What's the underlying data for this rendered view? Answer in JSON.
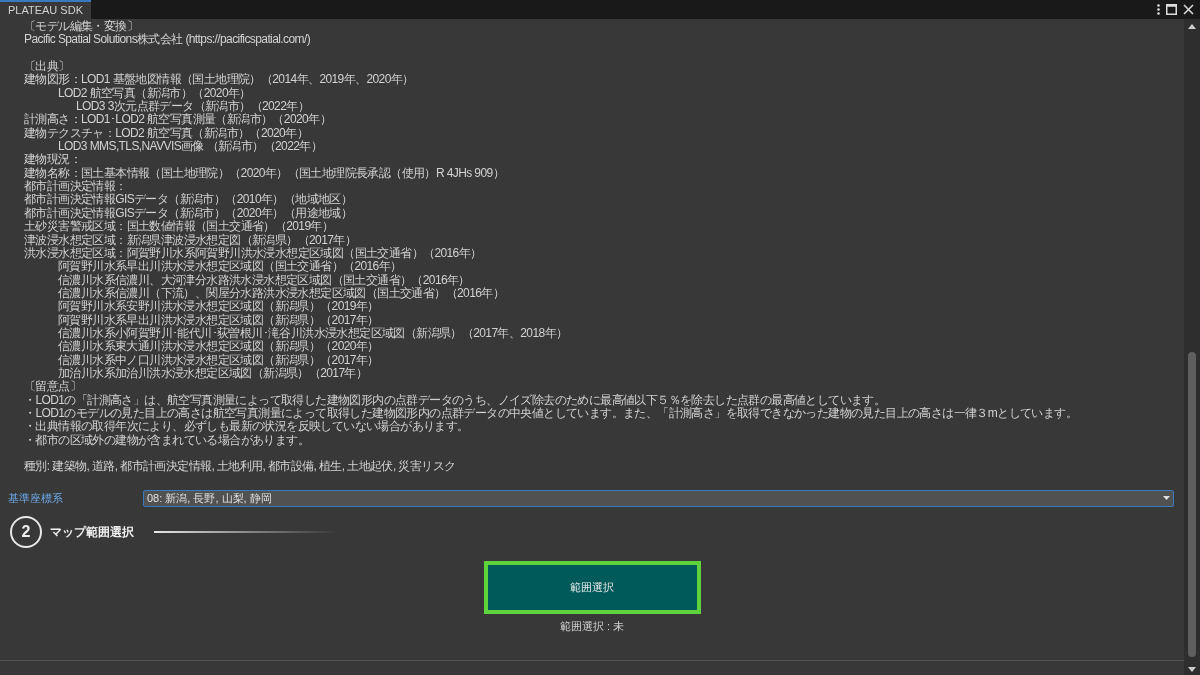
{
  "window": {
    "title": "PLATEAU SDK"
  },
  "license_text": {
    "sections": [
      {
        "lines": [
          {
            "text": "〔モデル編集・変換〕"
          },
          {
            "text": "Pacific Spatial Solutions株式会社 (https://pacificspatial.com/)"
          }
        ]
      },
      {
        "lines": [
          {
            "text": "〔出典〕"
          },
          {
            "text": "建物図形：LOD1 基盤地図情報（国土地理院）（2014年、2019年、2020年）",
            "children": [
              {
                "text": "LOD2 航空写真（新潟市）（2020年）",
                "children": [
                  {
                    "text": "LOD3 3次元点群データ（新潟市）（2022年）"
                  }
                ]
              }
            ]
          },
          {
            "text": "計測高さ：LOD1･LOD2 航空写真測量（新潟市）（2020年）"
          },
          {
            "text": "建物テクスチャ：LOD2 航空写真（新潟市）（2020年）",
            "children": [
              {
                "text": "LOD3 MMS,TLS,NAVVIS画像 （新潟市）（2022年）"
              }
            ]
          },
          {
            "text": "建物現況："
          },
          {
            "text": "建物名称：国土基本情報（国土地理院）（2020年）（国土地理院長承認（使用）R 4JHs 909）"
          },
          {
            "text": "都市計画決定情報："
          },
          {
            "text": "都市計画決定情報GISデータ（新潟市）（2010年）（地域地区）"
          },
          {
            "text": "都市計画決定情報GISデータ（新潟市）（2020年）（用途地域）"
          },
          {
            "text": "土砂災害警戒区域：国土数値情報（国土交通省）（2019年）"
          },
          {
            "text": "津波浸水想定区域：新潟県津波浸水想定図（新潟県）（2017年）"
          },
          {
            "text": "洪水浸水想定区域：阿賀野川水系阿賀野川洪水浸水想定区域図（国土交通省）（2016年）",
            "children": [
              {
                "text": "阿賀野川水系早出川洪水浸水想定区域図（国土交通省）（2016年）"
              },
              {
                "text": "信濃川水系信濃川、大河津分水路洪水浸水想定区域図（国土交通省）（2016年）"
              },
              {
                "text": "信濃川水系信濃川（下流）、関屋分水路洪水浸水想定区域図（国土交通省）（2016年）"
              },
              {
                "text": "阿賀野川水系安野川洪水浸水想定区域図（新潟県）（2019年）"
              },
              {
                "text": "阿賀野川水系早出川洪水浸水想定区域図（新潟県）（2017年）"
              },
              {
                "text": "信濃川水系小阿賀野川･能代川･荻曽根川･滝谷川洪水浸水想定区域図（新潟県）（2017年、2018年）"
              },
              {
                "text": "信濃川水系東大通川洪水浸水想定区域図（新潟県）（2020年）"
              },
              {
                "text": "信濃川水系中ノ口川洪水浸水想定区域図（新潟県）（2017年）"
              },
              {
                "text": "加治川水系加治川洪水浸水想定区域図（新潟県）（2017年）"
              }
            ]
          },
          {
            "text": "〔留意点〕"
          },
          {
            "text": "・LOD1の「計測高さ」は、航空写真測量によって取得した建物図形内の点群データのうち、ノイズ除去のために最高値以下５％を除去した点群の最高値としています。"
          },
          {
            "text": "・LOD1のモデルの見た目上の高さは航空写真測量によって取得した建物図形内の点群データの中央値としています。また、「計測高さ」を取得できなかった建物の見た目上の高さは一律３mとしています。"
          },
          {
            "text": "・出典情報の取得年次により、必ずしも最新の状況を反映していない場合があります。"
          },
          {
            "text": "・都市の区域外の建物が含まれている場合があります。"
          }
        ]
      },
      {
        "lines": [
          {
            "text": "種別: 建築物, 道路, 都市計画決定情報, 土地利用, 都市設備, 植生, 土地起伏, 災害リスク"
          }
        ]
      }
    ]
  },
  "coordinate_system": {
    "label": "基準座標系",
    "value": "08: 新潟, 長野, 山梨, 静岡"
  },
  "step": {
    "number": "2",
    "title": "マップ範囲選択"
  },
  "select_button": {
    "label": "範囲選択"
  },
  "selection_status": "範囲選択 : 未"
}
